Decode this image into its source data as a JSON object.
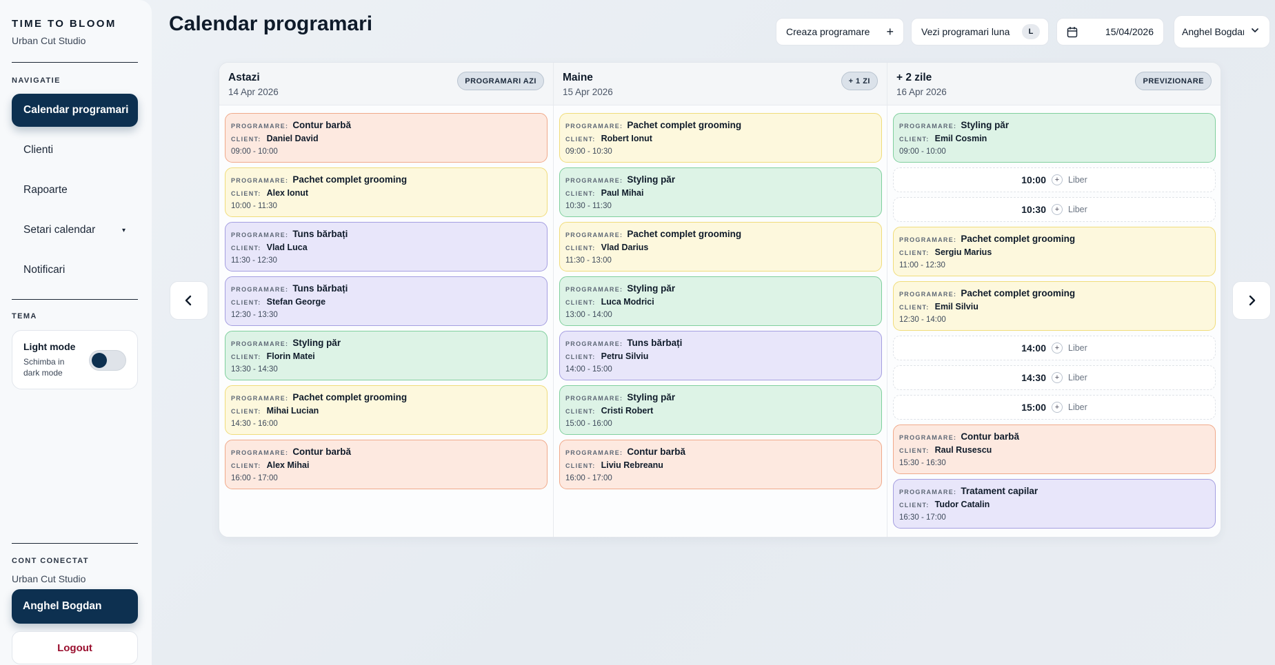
{
  "sidebar": {
    "brand": "TIME TO BLOOM",
    "studio": "Urban Cut Studio",
    "nav_label": "NAVIGATIE",
    "nav": [
      {
        "label": "Calendar programari",
        "active": true
      },
      {
        "label": "Clienti"
      },
      {
        "label": "Rapoarte"
      },
      {
        "label": "Setari calendar",
        "caret": "▾"
      },
      {
        "label": "Notificari"
      }
    ],
    "theme_label": "TEMA",
    "theme_title": "Light mode",
    "theme_sub": "Schimba in dark mode",
    "account_label": "CONT CONECTAT",
    "account_studio": "Urban Cut Studio",
    "user": "Anghel Bogdan",
    "logout": "Logout"
  },
  "header": {
    "title": "Calendar programari",
    "create": "Creaza programare",
    "create_icon": "+",
    "month": "Vezi programari luna",
    "month_badge": "L",
    "date": "15/04/2026",
    "user": "Anghel Bogdan"
  },
  "labels": {
    "programare": "PROGRAMARE:",
    "client": "CLIENT:",
    "free": "Liber"
  },
  "colors": {
    "accent": "#0d3050",
    "logout": "#9a0f2e",
    "orange": "#fde9e0",
    "yellow": "#fdf8dd",
    "purple": "#e8e6fa",
    "green": "#ddf3e6"
  },
  "columns": [
    {
      "title": "Astazi",
      "date": "14 Apr 2026",
      "badge": "PROGRAMARI AZI",
      "slots": [
        {
          "type": "appt",
          "tone": "orange",
          "service": "Contur barbă",
          "client": "Daniel David",
          "time": "09:00 - 10:00"
        },
        {
          "type": "appt",
          "tone": "yellow",
          "service": "Pachet complet grooming",
          "client": "Alex Ionut",
          "time": "10:00 - 11:30"
        },
        {
          "type": "appt",
          "tone": "purple",
          "service": "Tuns bărbați",
          "client": "Vlad Luca",
          "time": "11:30 - 12:30"
        },
        {
          "type": "appt",
          "tone": "purple",
          "service": "Tuns bărbați",
          "client": "Stefan George",
          "time": "12:30 - 13:30"
        },
        {
          "type": "appt",
          "tone": "green",
          "service": "Styling păr",
          "client": "Florin Matei",
          "time": "13:30 - 14:30"
        },
        {
          "type": "appt",
          "tone": "yellow",
          "service": "Pachet complet grooming",
          "client": "Mihai Lucian",
          "time": "14:30 - 16:00"
        },
        {
          "type": "appt",
          "tone": "orange",
          "service": "Contur barbă",
          "client": "Alex Mihai",
          "time": "16:00 - 17:00"
        }
      ]
    },
    {
      "title": "Maine",
      "date": "15 Apr 2026",
      "badge": "+ 1 ZI",
      "slots": [
        {
          "type": "appt",
          "tone": "yellow",
          "service": "Pachet complet grooming",
          "client": "Robert Ionut",
          "time": "09:00 - 10:30"
        },
        {
          "type": "appt",
          "tone": "green",
          "service": "Styling păr",
          "client": "Paul Mihai",
          "time": "10:30 - 11:30"
        },
        {
          "type": "appt",
          "tone": "yellow",
          "service": "Pachet complet grooming",
          "client": "Vlad Darius",
          "time": "11:30 - 13:00"
        },
        {
          "type": "appt",
          "tone": "green",
          "service": "Styling păr",
          "client": "Luca Modrici",
          "time": "13:00 - 14:00"
        },
        {
          "type": "appt",
          "tone": "purple",
          "service": "Tuns bărbați",
          "client": "Petru Silviu",
          "time": "14:00 - 15:00"
        },
        {
          "type": "appt",
          "tone": "green",
          "service": "Styling păr",
          "client": "Cristi Robert",
          "time": "15:00 - 16:00"
        },
        {
          "type": "appt",
          "tone": "orange",
          "service": "Contur barbă",
          "client": "Liviu Rebreanu",
          "time": "16:00 - 17:00"
        }
      ]
    },
    {
      "title": "+ 2 zile",
      "date": "16 Apr 2026",
      "badge": "PREVIZIONARE",
      "slots": [
        {
          "type": "appt",
          "tone": "green",
          "service": "Styling păr",
          "client": "Emil Cosmin",
          "time": "09:00 - 10:00"
        },
        {
          "type": "free",
          "time": "10:00"
        },
        {
          "type": "free",
          "time": "10:30"
        },
        {
          "type": "appt",
          "tone": "yellow",
          "service": "Pachet complet grooming",
          "client": "Sergiu Marius",
          "time": "11:00 - 12:30"
        },
        {
          "type": "appt",
          "tone": "yellow",
          "service": "Pachet complet grooming",
          "client": "Emil Silviu",
          "time": "12:30 - 14:00"
        },
        {
          "type": "free",
          "time": "14:00"
        },
        {
          "type": "free",
          "time": "14:30"
        },
        {
          "type": "free",
          "time": "15:00"
        },
        {
          "type": "appt",
          "tone": "orange",
          "service": "Contur barbă",
          "client": "Raul Rusescu",
          "time": "15:30 - 16:30"
        },
        {
          "type": "appt",
          "tone": "purple",
          "service": "Tratament capilar",
          "client": "Tudor Catalin",
          "time": "16:30 - 17:00"
        }
      ]
    }
  ]
}
